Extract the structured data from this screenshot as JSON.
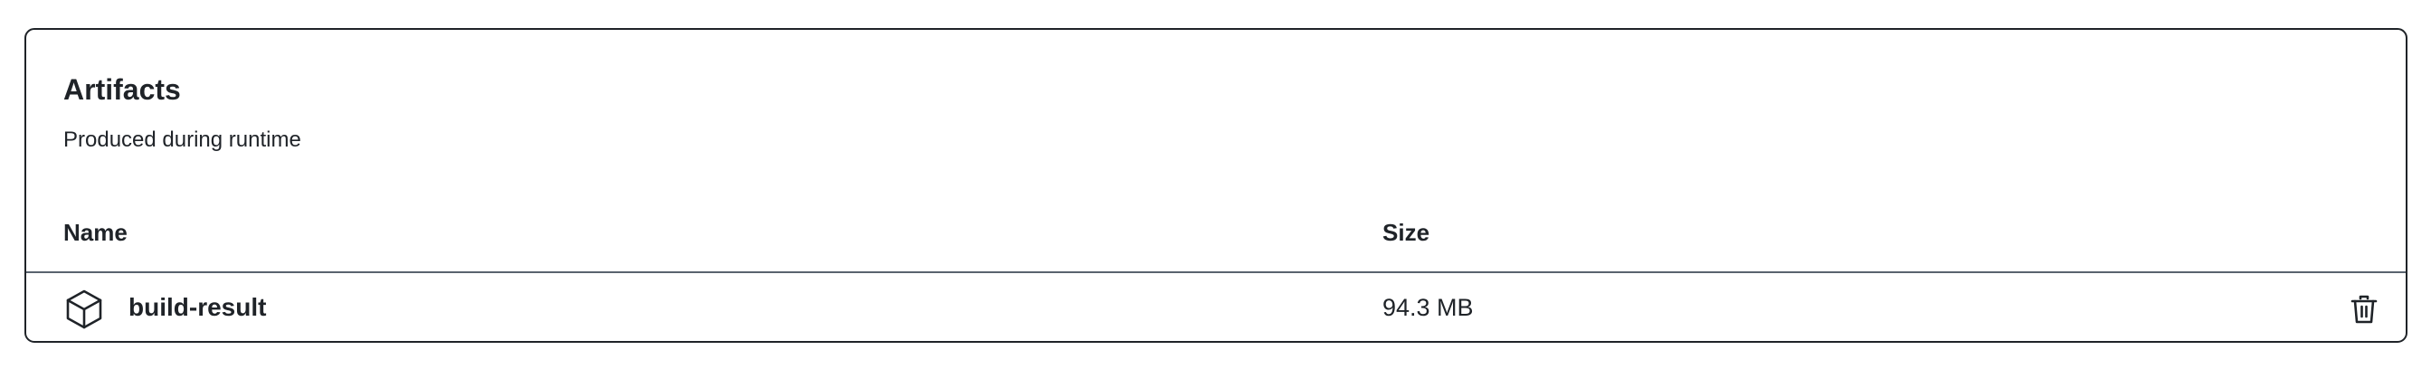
{
  "artifacts_panel": {
    "title": "Artifacts",
    "subtitle": "Produced during runtime",
    "columns": {
      "name": "Name",
      "size": "Size"
    },
    "rows": [
      {
        "icon": "package-icon",
        "name": "build-result",
        "size": "94.3 MB",
        "action_icon": "trash-icon"
      }
    ]
  },
  "colors": {
    "text": "#1f2328",
    "border": "#1f2328",
    "divider": "#59636e",
    "background": "#ffffff"
  }
}
